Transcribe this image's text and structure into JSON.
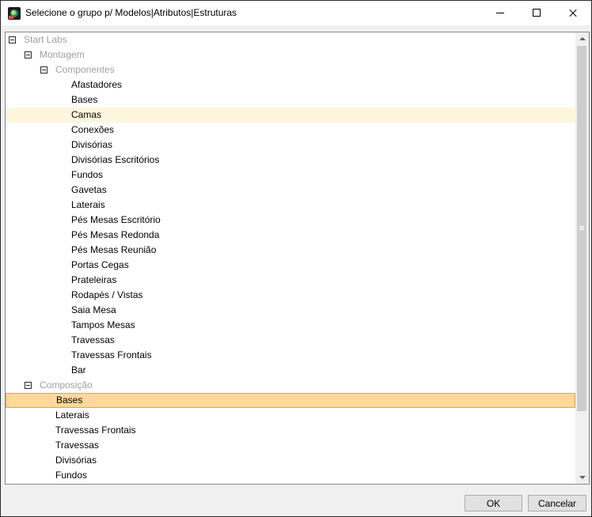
{
  "window": {
    "title": "Selecione o grupo p/ Modelos|Atributos|Estruturas"
  },
  "tree": {
    "root": {
      "label": "Start Labs",
      "expanded": true
    },
    "montagem": {
      "label": "Montagem",
      "expanded": true
    },
    "componentes": {
      "label": "Componentes",
      "expanded": true,
      "items": [
        "Afastadores",
        "Bases",
        "Camas",
        "Conexões",
        "Divisórias",
        "Divisórias Escritórios",
        "Fundos",
        "Gavetas",
        "Laterais",
        "Pés Mesas Escritório",
        "Pés Mesas Redonda",
        "Pés Mesas Reunião",
        "Portas Cegas",
        "Prateleiras",
        "Rodapés / Vistas",
        "Saia Mesa",
        "Tampos Mesas",
        "Travessas",
        "Travessas Frontais",
        "Bar"
      ]
    },
    "composicao": {
      "label": "Composição",
      "expanded": true,
      "items": [
        "Bases",
        "Laterais",
        "Travessas Frontais",
        "Travessas",
        "Divisórias",
        "Fundos"
      ]
    },
    "hovered_item": "Camas",
    "selected_item": "Bases"
  },
  "buttons": {
    "ok": "OK",
    "cancel": "Cancelar"
  },
  "colors": {
    "selection_fill": "#fcd99a",
    "selection_border": "#e8a63a",
    "hover_fill": "#fdf5dd",
    "group_text": "#a0a0a0"
  }
}
